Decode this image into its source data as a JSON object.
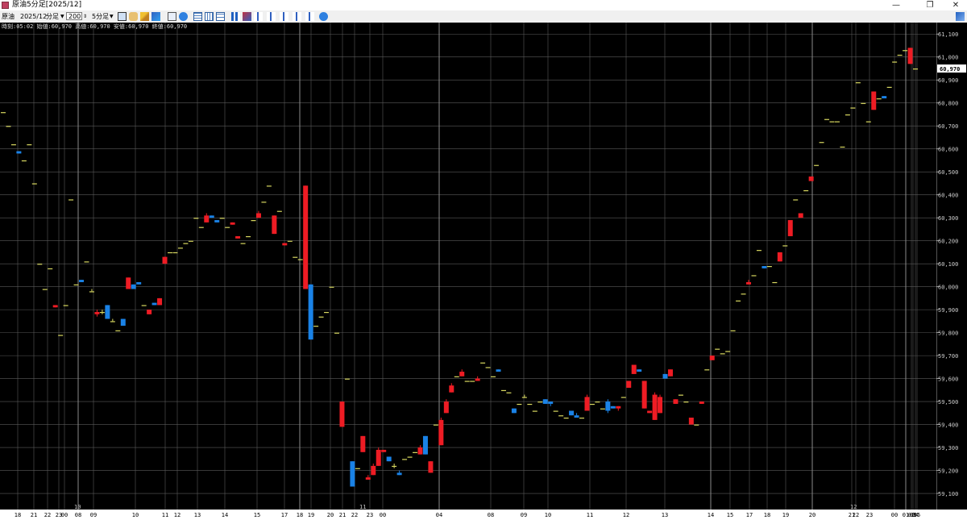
{
  "window": {
    "title": "原油5分足[2025/12]",
    "buttons": {
      "minimize": "—",
      "restore": "❐",
      "close": "✕"
    }
  },
  "toolbar": {
    "instrument": "原油",
    "contract": "2025/12",
    "period_unit": "分足",
    "bar_count": "200",
    "interval": "5分足"
  },
  "info_line": "時刻:05:02 始値:60,970 高値:60,970 安値:60,970 終値:60,970",
  "current_price_label": "60,970",
  "colors": {
    "up": "#ee1c24",
    "down": "#1a82e6",
    "doji": "#d8d860",
    "grid": "#5a5a5a"
  },
  "chart_data": {
    "type": "candlestick",
    "ylim": [
      59030,
      61150
    ],
    "y_ticks": [
      "61,100",
      "61,000",
      "60,900",
      "60,800",
      "60,700",
      "60,600",
      "60,500",
      "60,400",
      "60,300",
      "60,200",
      "60,100",
      "60,000",
      "59,900",
      "59,800",
      "59,700",
      "59,600",
      "59,500",
      "59,400",
      "59,300",
      "59,200",
      "59,100"
    ],
    "month_labels": [
      "10",
      "11",
      "12"
    ],
    "x_labels": [
      "18",
      "21",
      "22",
      "23",
      "00",
      "08",
      "09",
      "10",
      "11",
      "12",
      "13",
      "14",
      "15",
      "17",
      "18",
      "19",
      "20",
      "21",
      "22",
      "23",
      "00",
      "04",
      "08",
      "09",
      "10",
      "11",
      "12",
      "13",
      "14",
      "15",
      "17",
      "18",
      "19",
      "20",
      "21",
      "22",
      "23",
      "00",
      "01",
      "02",
      "03",
      "04",
      "05"
    ],
    "candles": [
      [
        60760,
        60760,
        60760,
        60760
      ],
      [
        60700,
        60700,
        60700,
        60700
      ],
      [
        60620,
        60620,
        60620,
        60620
      ],
      [
        60590,
        60590,
        60580,
        60580
      ],
      [
        60550,
        60550,
        60550,
        60550
      ],
      [
        60620,
        60620,
        60620,
        60620
      ],
      [
        60450,
        60450,
        60450,
        60450
      ],
      [
        60100,
        60100,
        60100,
        60100
      ],
      [
        59990,
        59990,
        59990,
        59990
      ],
      [
        60080,
        60080,
        60080,
        60080
      ],
      [
        59910,
        59920,
        59910,
        59920
      ],
      [
        59790,
        59790,
        59790,
        59790
      ],
      [
        59920,
        59920,
        59920,
        59920
      ],
      [
        60380,
        60380,
        60380,
        60380
      ],
      [
        60010,
        60010,
        60010,
        60010
      ],
      [
        60030,
        60030,
        60020,
        60020
      ],
      [
        60110,
        60110,
        60110,
        60110
      ],
      [
        59980,
        59990,
        59980,
        59980
      ],
      [
        59880,
        59900,
        59870,
        59890
      ],
      [
        59890,
        59900,
        59880,
        59890
      ],
      [
        59920,
        59920,
        59860,
        59860
      ],
      [
        59850,
        59860,
        59850,
        59850
      ],
      [
        59810,
        59810,
        59810,
        59810
      ],
      [
        59860,
        59860,
        59830,
        59830
      ],
      [
        59990,
        60040,
        59990,
        60040
      ],
      [
        60010,
        60010,
        59990,
        59990
      ],
      [
        60020,
        60020,
        60010,
        60010
      ],
      [
        59920,
        59920,
        59920,
        59920
      ],
      [
        59880,
        59900,
        59880,
        59900
      ],
      [
        59930,
        59930,
        59920,
        59920
      ],
      [
        59920,
        59950,
        59920,
        59950
      ],
      [
        60100,
        60130,
        60100,
        60130
      ],
      [
        60150,
        60150,
        60150,
        60150
      ],
      [
        60150,
        60150,
        60150,
        60150
      ],
      [
        60170,
        60170,
        60170,
        60170
      ],
      [
        60190,
        60190,
        60190,
        60190
      ],
      [
        60200,
        60200,
        60200,
        60200
      ],
      [
        60300,
        60300,
        60300,
        60300
      ],
      [
        60260,
        60260,
        60260,
        60260
      ],
      [
        60280,
        60320,
        60280,
        60310
      ],
      [
        60310,
        60310,
        60300,
        60300
      ],
      [
        60290,
        60290,
        60280,
        60280
      ],
      [
        60300,
        60300,
        60300,
        60300
      ],
      [
        60260,
        60260,
        60260,
        60260
      ],
      [
        60270,
        60280,
        60270,
        60280
      ],
      [
        60210,
        60220,
        60210,
        60220
      ],
      [
        60190,
        60190,
        60190,
        60190
      ],
      [
        60220,
        60220,
        60220,
        60220
      ],
      [
        60290,
        60290,
        60290,
        60290
      ],
      [
        60300,
        60330,
        60300,
        60320
      ],
      [
        60370,
        60370,
        60370,
        60370
      ],
      [
        60440,
        60440,
        60440,
        60440
      ],
      [
        60230,
        60310,
        60230,
        60310
      ],
      [
        60330,
        60330,
        60330,
        60330
      ],
      [
        60180,
        60190,
        60180,
        60190
      ],
      [
        60200,
        60200,
        60200,
        60200
      ],
      [
        60130,
        60130,
        60130,
        60130
      ],
      [
        60120,
        60120,
        60120,
        60120
      ],
      [
        59990,
        60440,
        59990,
        60440
      ],
      [
        60010,
        60010,
        59770,
        59770
      ],
      [
        59830,
        59830,
        59830,
        59830
      ],
      [
        59870,
        59870,
        59870,
        59870
      ],
      [
        59890,
        59890,
        59890,
        59890
      ],
      [
        60000,
        60000,
        60000,
        60000
      ],
      [
        59800,
        59800,
        59800,
        59800
      ],
      [
        59390,
        59500,
        59390,
        59500
      ],
      [
        59600,
        59600,
        59600,
        59600
      ],
      [
        59240,
        59240,
        59130,
        59130
      ],
      [
        59210,
        59210,
        59210,
        59210
      ],
      [
        59280,
        59350,
        59280,
        59350
      ],
      [
        59160,
        59180,
        59160,
        59170
      ],
      [
        59180,
        59230,
        59180,
        59220
      ],
      [
        59220,
        59300,
        59220,
        59290
      ],
      [
        59280,
        59290,
        59280,
        59290
      ],
      [
        59260,
        59260,
        59240,
        59240
      ],
      [
        59220,
        59230,
        59210,
        59220
      ],
      [
        59190,
        59200,
        59180,
        59180
      ],
      [
        59250,
        59250,
        59250,
        59250
      ],
      [
        59260,
        59260,
        59260,
        59260
      ],
      [
        59280,
        59280,
        59280,
        59280
      ],
      [
        59270,
        59310,
        59270,
        59300
      ],
      [
        59350,
        59350,
        59270,
        59270
      ],
      [
        59190,
        59240,
        59190,
        59240
      ],
      [
        59400,
        59400,
        59400,
        59400
      ],
      [
        59310,
        59430,
        59310,
        59420
      ],
      [
        59450,
        59510,
        59450,
        59500
      ],
      [
        59540,
        59580,
        59540,
        59570
      ],
      [
        59610,
        59610,
        59610,
        59610
      ],
      [
        59610,
        59640,
        59610,
        59630
      ],
      [
        59590,
        59590,
        59590,
        59590
      ],
      [
        59590,
        59590,
        59590,
        59590
      ],
      [
        59590,
        59610,
        59590,
        59600
      ],
      [
        59670,
        59670,
        59670,
        59670
      ],
      [
        59650,
        59650,
        59650,
        59650
      ],
      [
        59610,
        59610,
        59610,
        59610
      ],
      [
        59640,
        59640,
        59630,
        59630
      ],
      [
        59550,
        59550,
        59550,
        59550
      ],
      [
        59540,
        59540,
        59540,
        59540
      ],
      [
        59470,
        59470,
        59450,
        59450
      ],
      [
        59490,
        59490,
        59490,
        59490
      ],
      [
        59520,
        59530,
        59520,
        59520
      ],
      [
        59490,
        59490,
        59490,
        59490
      ],
      [
        59460,
        59460,
        59460,
        59460
      ],
      [
        59500,
        59500,
        59500,
        59500
      ],
      [
        59510,
        59510,
        59490,
        59490
      ],
      [
        59500,
        59500,
        59480,
        59490
      ],
      [
        59460,
        59460,
        59460,
        59460
      ],
      [
        59440,
        59440,
        59440,
        59440
      ],
      [
        59430,
        59430,
        59430,
        59430
      ],
      [
        59460,
        59460,
        59440,
        59440
      ],
      [
        59440,
        59450,
        59430,
        59430
      ],
      [
        59430,
        59430,
        59430,
        59430
      ],
      [
        59460,
        59530,
        59460,
        59520
      ],
      [
        59490,
        59490,
        59490,
        59490
      ],
      [
        59500,
        59500,
        59500,
        59500
      ],
      [
        59470,
        59470,
        59470,
        59470
      ],
      [
        59500,
        59510,
        59450,
        59460
      ],
      [
        59480,
        59480,
        59470,
        59470
      ],
      [
        59470,
        59480,
        59460,
        59480
      ],
      [
        59520,
        59520,
        59520,
        59520
      ],
      [
        59560,
        59590,
        59560,
        59590
      ],
      [
        59620,
        59660,
        59620,
        59660
      ],
      [
        59640,
        59640,
        59630,
        59630
      ],
      [
        59470,
        59590,
        59470,
        59590
      ],
      [
        59450,
        59460,
        59450,
        59460
      ],
      [
        59420,
        59540,
        59420,
        59530
      ],
      [
        59450,
        59530,
        59450,
        59520
      ],
      [
        59620,
        59620,
        59600,
        59600
      ],
      [
        59610,
        59640,
        59610,
        59640
      ],
      [
        59490,
        59510,
        59490,
        59510
      ],
      [
        59530,
        59530,
        59530,
        59530
      ],
      [
        59500,
        59500,
        59500,
        59500
      ],
      [
        59400,
        59430,
        59400,
        59430
      ],
      [
        59400,
        59400,
        59400,
        59400
      ],
      [
        59490,
        59500,
        59490,
        59500
      ],
      [
        59640,
        59640,
        59640,
        59640
      ],
      [
        59680,
        59700,
        59680,
        59700
      ],
      [
        59730,
        59730,
        59730,
        59730
      ],
      [
        59710,
        59710,
        59710,
        59710
      ],
      [
        59720,
        59720,
        59720,
        59720
      ],
      [
        59810,
        59810,
        59810,
        59810
      ],
      [
        59940,
        59940,
        59940,
        59940
      ],
      [
        59970,
        59970,
        59970,
        59970
      ],
      [
        60010,
        60030,
        60010,
        60020
      ],
      [
        60050,
        60050,
        60050,
        60050
      ],
      [
        60160,
        60160,
        60160,
        60160
      ],
      [
        60090,
        60090,
        60080,
        60080
      ],
      [
        60090,
        60090,
        60090,
        60090
      ],
      [
        60020,
        60020,
        60020,
        60020
      ],
      [
        60110,
        60150,
        60110,
        60150
      ],
      [
        60180,
        60180,
        60180,
        60180
      ],
      [
        60220,
        60290,
        60220,
        60290
      ],
      [
        60380,
        60380,
        60380,
        60380
      ],
      [
        60300,
        60320,
        60300,
        60320
      ],
      [
        60420,
        60420,
        60420,
        60420
      ],
      [
        60460,
        60480,
        60460,
        60480
      ],
      [
        60530,
        60530,
        60530,
        60530
      ],
      [
        60630,
        60630,
        60630,
        60630
      ],
      [
        60730,
        60730,
        60730,
        60730
      ],
      [
        60720,
        60720,
        60720,
        60720
      ],
      [
        60720,
        60720,
        60720,
        60720
      ],
      [
        60610,
        60610,
        60610,
        60610
      ],
      [
        60750,
        60750,
        60750,
        60750
      ],
      [
        60780,
        60780,
        60780,
        60780
      ],
      [
        60890,
        60890,
        60890,
        60890
      ],
      [
        60800,
        60800,
        60800,
        60800
      ],
      [
        60720,
        60720,
        60720,
        60720
      ],
      [
        60770,
        60850,
        60770,
        60850
      ],
      [
        60820,
        60820,
        60820,
        60820
      ],
      [
        60830,
        60830,
        60820,
        60820
      ],
      [
        60870,
        60870,
        60870,
        60870
      ],
      [
        60980,
        60980,
        60980,
        60980
      ],
      [
        61010,
        61010,
        61010,
        61010
      ],
      [
        61030,
        61030,
        61030,
        61030
      ],
      [
        60970,
        61040,
        60970,
        61040
      ],
      [
        60950,
        60950,
        60950,
        60950
      ]
    ]
  }
}
